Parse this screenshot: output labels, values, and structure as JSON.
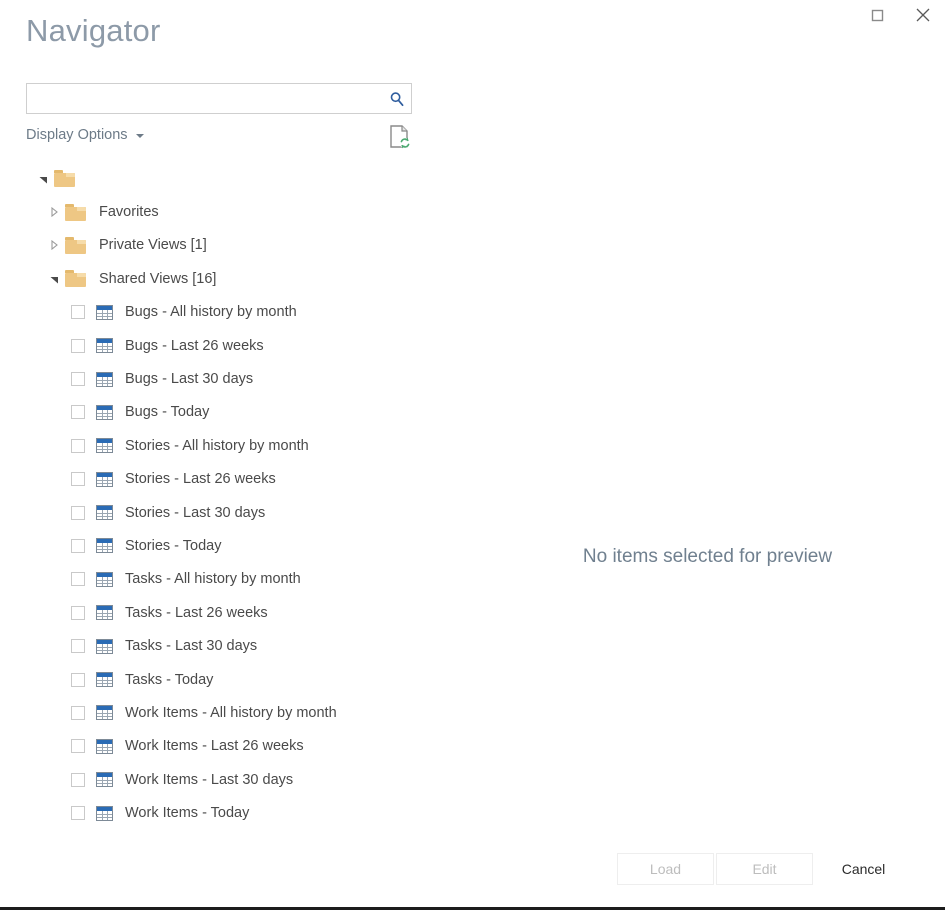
{
  "window": {
    "title": "Navigator",
    "controls": [
      {
        "name": "maximize-button",
        "icon": "maximize-icon"
      },
      {
        "name": "close-button",
        "icon": "close-icon"
      }
    ]
  },
  "search": {
    "value": "",
    "placeholder": "",
    "icon": "search-icon"
  },
  "toolbar": {
    "display_options_label": "Display Options",
    "caret_icon": "chevron-down-icon",
    "refresh_icon": "refresh-document-icon"
  },
  "tree": {
    "root": {
      "label": "",
      "expanded": true,
      "icon": "folder-icon"
    },
    "folders": [
      {
        "label": "Favorites",
        "expanded": false,
        "icon": "folder-icon"
      },
      {
        "label": "Private Views [1]",
        "expanded": false,
        "icon": "folder-icon"
      },
      {
        "label": "Shared Views [16]",
        "expanded": true,
        "icon": "folder-icon"
      }
    ],
    "items": [
      {
        "label": "Bugs - All history by month",
        "checked": false,
        "icon": "table-icon"
      },
      {
        "label": "Bugs - Last 26 weeks",
        "checked": false,
        "icon": "table-icon"
      },
      {
        "label": "Bugs - Last 30 days",
        "checked": false,
        "icon": "table-icon"
      },
      {
        "label": "Bugs - Today",
        "checked": false,
        "icon": "table-icon"
      },
      {
        "label": "Stories - All history by month",
        "checked": false,
        "icon": "table-icon"
      },
      {
        "label": "Stories - Last 26 weeks",
        "checked": false,
        "icon": "table-icon"
      },
      {
        "label": "Stories - Last 30 days",
        "checked": false,
        "icon": "table-icon"
      },
      {
        "label": "Stories - Today",
        "checked": false,
        "icon": "table-icon"
      },
      {
        "label": "Tasks - All history by month",
        "checked": false,
        "icon": "table-icon"
      },
      {
        "label": "Tasks - Last 26 weeks",
        "checked": false,
        "icon": "table-icon"
      },
      {
        "label": "Tasks - Last 30 days",
        "checked": false,
        "icon": "table-icon"
      },
      {
        "label": "Tasks - Today",
        "checked": false,
        "icon": "table-icon"
      },
      {
        "label": "Work Items - All history by month",
        "checked": false,
        "icon": "table-icon"
      },
      {
        "label": "Work Items - Last 26 weeks",
        "checked": false,
        "icon": "table-icon"
      },
      {
        "label": "Work Items - Last 30 days",
        "checked": false,
        "icon": "table-icon"
      },
      {
        "label": "Work Items - Today",
        "checked": false,
        "icon": "table-icon"
      }
    ]
  },
  "preview": {
    "empty_message": "No items selected for preview"
  },
  "footer": {
    "buttons": [
      {
        "label": "Load",
        "state": "disabled"
      },
      {
        "label": "Edit",
        "state": "disabled"
      },
      {
        "label": "Cancel",
        "state": "enabled"
      }
    ]
  },
  "colors": {
    "title": "#8d9aa8",
    "folder": "#eec784",
    "table_header": "#2a6bb5",
    "search_icon": "#2f5d9e",
    "refresh_badge": "#4aa870",
    "text": "#4a4a4a",
    "disabled_text": "#bdbdbd"
  }
}
